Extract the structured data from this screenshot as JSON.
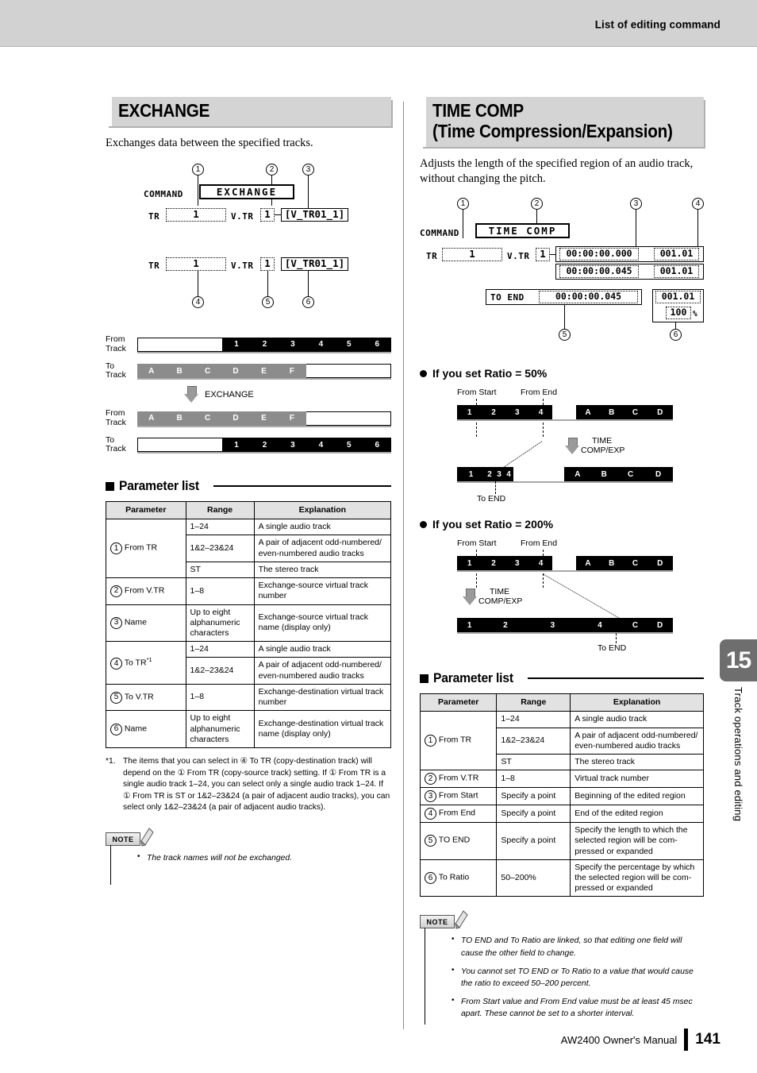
{
  "header": {
    "title": "List of editing command"
  },
  "footer": {
    "manual": "AW2400  Owner's Manual",
    "page": "141"
  },
  "side_tab": {
    "number": "15",
    "label": "Track operations and editing"
  },
  "left": {
    "section_title": "EXCHANGE",
    "lead": "Exchanges data between the specified tracks.",
    "lcd": {
      "command_label": "COMMAND",
      "command_value": "EXCHANGE",
      "row1": {
        "tr_label": "TR",
        "tr_value": "1",
        "vtr_label": "V.TR",
        "vtr_value": "1",
        "name_value": "[V_TR01_1]"
      },
      "row2": {
        "tr_label": "TR",
        "tr_value": "1",
        "vtr_label": "V.TR",
        "vtr_value": "1",
        "name_value": "[V_TR01_1]"
      },
      "callouts_top": [
        "1",
        "2",
        "3"
      ],
      "callouts_bottom": [
        "4",
        "5",
        "6"
      ]
    },
    "diagram": {
      "from_label": "From\nTrack",
      "to_label": "To\nTrack",
      "arrow_label": "EXCHANGE",
      "numeric_segments": [
        "1",
        "2",
        "3",
        "4",
        "5",
        "6"
      ],
      "letter_segments": [
        "A",
        "B",
        "C",
        "D",
        "E",
        "F"
      ]
    },
    "plist_heading": "Parameter list",
    "table": {
      "headers": [
        "Parameter",
        "Range",
        "Explanation"
      ],
      "rows": [
        {
          "num": "1",
          "param": "From TR",
          "sup": "",
          "ranges": [
            {
              "range": "1–24",
              "expl": "A single audio track"
            },
            {
              "range": "1&2–23&24",
              "expl": "A pair of adjacent odd-numbered/ even-numbered audio tracks"
            },
            {
              "range": "ST",
              "expl": "The stereo track"
            }
          ]
        },
        {
          "num": "2",
          "param": "From V.TR",
          "sup": "",
          "ranges": [
            {
              "range": "1–8",
              "expl": "Exchange-source virtual track number"
            }
          ]
        },
        {
          "num": "3",
          "param": "Name",
          "sup": "",
          "ranges": [
            {
              "range": "Up to eight alphanumeric characters",
              "expl": "Exchange-source virtual track name (display only)"
            }
          ]
        },
        {
          "num": "4",
          "param": "To TR",
          "sup": "*1",
          "ranges": [
            {
              "range": "1–24",
              "expl": "A single audio track"
            },
            {
              "range": "1&2–23&24",
              "expl": "A pair of adjacent odd-numbered/ even-numbered audio tracks"
            }
          ]
        },
        {
          "num": "5",
          "param": "To V.TR",
          "sup": "",
          "ranges": [
            {
              "range": "1–8",
              "expl": "Exchange-destination virtual track number"
            }
          ]
        },
        {
          "num": "6",
          "param": "Name",
          "sup": "",
          "ranges": [
            {
              "range": "Up to eight alphanumeric characters",
              "expl": "Exchange-destination virtual track name (display only)"
            }
          ]
        }
      ]
    },
    "footnote": {
      "mark": "*1.",
      "text": "The items that you can select in ④ To TR (copy-destination track) will depend on the ① From TR (copy-source track) setting. If ① From TR is a single audio track 1–24, you can select only a single audio track 1–24. If ① From TR is ST or 1&2–23&24 (a pair of adjacent audio tracks), you can select only 1&2–23&24 (a pair of adjacent audio tracks)."
    },
    "note": {
      "tag": "NOTE",
      "items": [
        "The track names will not be exchanged."
      ]
    }
  },
  "right": {
    "section_title_line1": "TIME COMP",
    "section_title_line2": "(Time Compression/Expansion)",
    "lead": "Adjusts the length of the specified region of an audio track, without changing the pitch.",
    "lcd": {
      "command_label": "COMMAND",
      "command_value": "TIME COMP",
      "tr_label": "TR",
      "tr_value": "1",
      "vtr_label": "V.TR",
      "vtr_value": "1",
      "from_start": "00:00:00.000",
      "from_start_bar": "001.01",
      "from_end": "00:00:00.045",
      "from_end_bar": "001.01",
      "to_end_label": "TO END",
      "to_end_value": "00:00:00.045",
      "to_bar": "001.01",
      "ratio_value": "100",
      "ratio_unit": "%",
      "callouts_top": [
        "1",
        "2",
        "3",
        "4"
      ],
      "callouts_bottom": [
        "5",
        "6"
      ]
    },
    "ratio50": {
      "heading": "If you set Ratio = 50%",
      "from_start_label": "From Start",
      "from_end_label": "From End",
      "arrow_label_line1": "TIME",
      "arrow_label_line2": "COMP/EXP",
      "to_end_label": "To END",
      "top_segments": [
        "1",
        "2",
        "3",
        "4",
        "",
        "A",
        "B",
        "C",
        "D"
      ],
      "bottom_segments": [
        "1",
        "2",
        "3",
        "4",
        "",
        "A",
        "B",
        "C",
        "D"
      ]
    },
    "ratio200": {
      "heading": "If you set Ratio = 200%",
      "from_start_label": "From Start",
      "from_end_label": "From End",
      "arrow_label_line1": "TIME",
      "arrow_label_line2": "COMP/EXP",
      "to_end_label": "To END",
      "top_segments": [
        "1",
        "2",
        "3",
        "4",
        "",
        "A",
        "B",
        "C",
        "D"
      ],
      "bottom_segments": [
        "1",
        "2",
        "3",
        "4",
        "C",
        "D"
      ]
    },
    "plist_heading": "Parameter list",
    "table": {
      "headers": [
        "Parameter",
        "Range",
        "Explanation"
      ],
      "rows": [
        {
          "num": "1",
          "param": "From TR",
          "ranges": [
            {
              "range": "1–24",
              "expl": "A single audio track"
            },
            {
              "range": "1&2–23&24",
              "expl": "A pair of adjacent odd-numbered/ even-numbered audio tracks"
            },
            {
              "range": "ST",
              "expl": "The stereo track"
            }
          ]
        },
        {
          "num": "2",
          "param": "From V.TR",
          "ranges": [
            {
              "range": "1–8",
              "expl": "Virtual track number"
            }
          ]
        },
        {
          "num": "3",
          "param": "From Start",
          "ranges": [
            {
              "range": "Specify a point",
              "expl": "Beginning of the edited region"
            }
          ]
        },
        {
          "num": "4",
          "param": "From End",
          "ranges": [
            {
              "range": "Specify a point",
              "expl": "End of the edited region"
            }
          ]
        },
        {
          "num": "5",
          "param": "TO END",
          "ranges": [
            {
              "range": "Specify a point",
              "expl": "Specify the length to which the selected region will be com- pressed or expanded"
            }
          ]
        },
        {
          "num": "6",
          "param": "To Ratio",
          "ranges": [
            {
              "range": "50–200%",
              "expl": "Specify the percentage by which the selected region will be com- pressed or expanded"
            }
          ]
        }
      ]
    },
    "note": {
      "tag": "NOTE",
      "items": [
        "TO END and To Ratio are linked, so that editing one field will cause the other field to change.",
        "You cannot set TO END or To Ratio to a value that would cause the ratio to exceed 50–200 percent.",
        "From Start value and From End value must be at least 45 msec apart. These cannot be set to a shorter interval."
      ]
    }
  }
}
